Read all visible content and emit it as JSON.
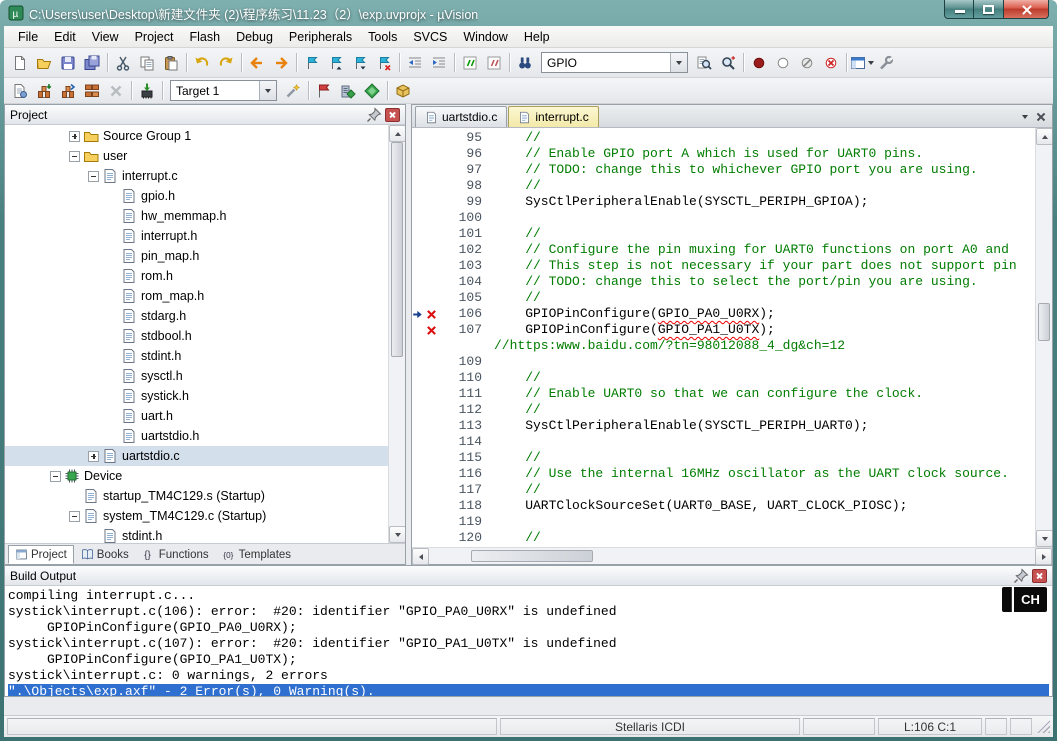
{
  "window": {
    "title": "C:\\Users\\user\\Desktop\\新建文件夹 (2)\\程序练习\\11.23（2）\\exp.uvprojx - µVision"
  },
  "menu": {
    "items": [
      "File",
      "Edit",
      "View",
      "Project",
      "Flash",
      "Debug",
      "Peripherals",
      "Tools",
      "SVCS",
      "Window",
      "Help"
    ]
  },
  "toolbar_file": {
    "items": [
      {
        "name": "new-file"
      },
      {
        "name": "open-file"
      },
      {
        "name": "save"
      },
      {
        "name": "save-all"
      },
      {
        "sep": true
      },
      {
        "name": "cut"
      },
      {
        "name": "copy"
      },
      {
        "name": "paste"
      },
      {
        "sep": true
      },
      {
        "name": "undo"
      },
      {
        "name": "redo"
      },
      {
        "sep": true
      },
      {
        "name": "navigate-back"
      },
      {
        "name": "navigate-forward"
      },
      {
        "sep": true
      },
      {
        "name": "bookmark-toggle"
      },
      {
        "name": "bookmark-prev"
      },
      {
        "name": "bookmark-next"
      },
      {
        "name": "bookmark-clear-all"
      },
      {
        "sep": true
      },
      {
        "name": "unindent"
      },
      {
        "name": "indent"
      },
      {
        "sep": true
      },
      {
        "name": "comment-selection"
      },
      {
        "name": "uncomment-selection"
      },
      {
        "sep": true
      },
      {
        "name": "find-in-files"
      },
      {
        "combo": "GPIO",
        "cname": "search"
      },
      {
        "name": "find"
      },
      {
        "name": "incremental-find"
      },
      {
        "sep": true
      },
      {
        "name": "breakpoint-toggle"
      },
      {
        "name": "breakpoint-enable-disable"
      },
      {
        "name": "breakpoint-disable-all"
      },
      {
        "name": "breakpoint-kill-all"
      },
      {
        "sep": true
      },
      {
        "name": "window-layout",
        "drop": true
      },
      {
        "name": "configure"
      }
    ]
  },
  "toolbar_build": {
    "items": [
      {
        "name": "translate"
      },
      {
        "name": "build"
      },
      {
        "name": "rebuild"
      },
      {
        "name": "batch-build"
      },
      {
        "name": "stop-build"
      },
      {
        "sep": true
      },
      {
        "name": "download"
      },
      {
        "sep": true
      },
      {
        "combo": "Target 1",
        "cname": "target-select"
      },
      {
        "name": "target-options"
      },
      {
        "sep": true
      },
      {
        "name": "file-extensions"
      },
      {
        "name": "manage-project-items"
      },
      {
        "name": "manage-rte"
      },
      {
        "sep": true
      },
      {
        "name": "pack-installer"
      }
    ]
  },
  "project_panel": {
    "title": "Project",
    "tree": [
      {
        "label": "Source Group 1",
        "depth": 2,
        "icon": "folder",
        "expander": "plus"
      },
      {
        "label": "user",
        "depth": 2,
        "icon": "folder",
        "expander": "minus"
      },
      {
        "label": "interrupt.c",
        "depth": 3,
        "icon": "file-c",
        "expander": "minus"
      },
      {
        "label": "gpio.h",
        "depth": 4,
        "icon": "file-h"
      },
      {
        "label": "hw_memmap.h",
        "depth": 4,
        "icon": "file-h"
      },
      {
        "label": "interrupt.h",
        "depth": 4,
        "icon": "file-h"
      },
      {
        "label": "pin_map.h",
        "depth": 4,
        "icon": "file-h"
      },
      {
        "label": "rom.h",
        "depth": 4,
        "icon": "file-h"
      },
      {
        "label": "rom_map.h",
        "depth": 4,
        "icon": "file-h"
      },
      {
        "label": "stdarg.h",
        "depth": 4,
        "icon": "file-h"
      },
      {
        "label": "stdbool.h",
        "depth": 4,
        "icon": "file-h"
      },
      {
        "label": "stdint.h",
        "depth": 4,
        "icon": "file-h"
      },
      {
        "label": "sysctl.h",
        "depth": 4,
        "icon": "file-h"
      },
      {
        "label": "systick.h",
        "depth": 4,
        "icon": "file-h"
      },
      {
        "label": "uart.h",
        "depth": 4,
        "icon": "file-h"
      },
      {
        "label": "uartstdio.h",
        "depth": 4,
        "icon": "file-h"
      },
      {
        "label": "uartstdio.c",
        "depth": 3,
        "icon": "file-c",
        "expander": "plus",
        "selected": true
      },
      {
        "label": "Device",
        "depth": 1,
        "icon": "device",
        "expander": "minus"
      },
      {
        "label": "startup_TM4C129.s (Startup)",
        "depth": 2,
        "icon": "file-s"
      },
      {
        "label": "system_TM4C129.c (Startup)",
        "depth": 2,
        "icon": "file-c",
        "expander": "minus"
      },
      {
        "label": "stdint.h",
        "depth": 3,
        "icon": "file-h"
      }
    ],
    "tabs": [
      {
        "label": "Project",
        "icon": "project-tab",
        "active": true
      },
      {
        "label": "Books",
        "icon": "books-tab"
      },
      {
        "label": "Functions",
        "icon": "functions-tab"
      },
      {
        "label": "Templates",
        "icon": "templates-tab"
      }
    ]
  },
  "editor": {
    "tabs": [
      {
        "label": "uartstdio.c",
        "active": false
      },
      {
        "label": "interrupt.c",
        "active": true
      }
    ],
    "lines": [
      {
        "num": "95",
        "parts": [
          {
            "t": "    //",
            "c": "com"
          }
        ]
      },
      {
        "num": "96",
        "parts": [
          {
            "t": "    // Enable GPIO port A which is used for UART0 pins.",
            "c": "com"
          }
        ]
      },
      {
        "num": "97",
        "parts": [
          {
            "t": "    // TODO: change this to whichever GPIO port you are using.",
            "c": "com"
          }
        ]
      },
      {
        "num": "98",
        "parts": [
          {
            "t": "    //",
            "c": "com"
          }
        ]
      },
      {
        "num": "99",
        "parts": [
          {
            "t": "    SysCtlPeripheralEnable(SYSCTL_PERIPH_GPIOA);",
            "c": "code"
          }
        ]
      },
      {
        "num": "100",
        "parts": []
      },
      {
        "num": "101",
        "parts": [
          {
            "t": "    //",
            "c": "com"
          }
        ]
      },
      {
        "num": "102",
        "parts": [
          {
            "t": "    // Configure the pin muxing for UART0 functions on port A0 and",
            "c": "com"
          }
        ]
      },
      {
        "num": "103",
        "parts": [
          {
            "t": "    // This step is not necessary if your part does not support pin",
            "c": "com"
          }
        ]
      },
      {
        "num": "104",
        "parts": [
          {
            "t": "    // TODO: change this to select the port/pin you are using.",
            "c": "com"
          }
        ]
      },
      {
        "num": "105",
        "parts": [
          {
            "t": "    //",
            "c": "com"
          }
        ]
      },
      {
        "num": "106",
        "marker": "error-current",
        "parts": [
          {
            "t": "    GPIOPinConfigure(",
            "c": "code"
          },
          {
            "t": "GPIO_PA0_U0RX",
            "c": "error"
          },
          {
            "t": ");",
            "c": "code"
          }
        ]
      },
      {
        "num": "107",
        "marker": "error",
        "parts": [
          {
            "t": "    GPIOPinConfigure(",
            "c": "code"
          },
          {
            "t": "GPIO_PA1_U0TX",
            "c": "error"
          },
          {
            "t": ");",
            "c": "code"
          }
        ]
      },
      {
        "num": "",
        "parts": [
          {
            "t": "//https:www.baidu.com/?tn=98012088_4_dg&ch=12",
            "c": "com"
          }
        ]
      },
      {
        "num": "109",
        "parts": []
      },
      {
        "num": "110",
        "parts": [
          {
            "t": "    //",
            "c": "com"
          }
        ]
      },
      {
        "num": "111",
        "parts": [
          {
            "t": "    // Enable UART0 so that we can configure the clock.",
            "c": "com"
          }
        ]
      },
      {
        "num": "112",
        "parts": [
          {
            "t": "    //",
            "c": "com"
          }
        ]
      },
      {
        "num": "113",
        "parts": [
          {
            "t": "    SysCtlPeripheralEnable(SYSCTL_PERIPH_UART0);",
            "c": "code"
          }
        ]
      },
      {
        "num": "114",
        "parts": []
      },
      {
        "num": "115",
        "parts": [
          {
            "t": "    //",
            "c": "com"
          }
        ]
      },
      {
        "num": "116",
        "parts": [
          {
            "t": "    // Use the internal 16MHz oscillator as the UART clock source.",
            "c": "com"
          }
        ]
      },
      {
        "num": "117",
        "parts": [
          {
            "t": "    //",
            "c": "com"
          }
        ]
      },
      {
        "num": "118",
        "parts": [
          {
            "t": "    UARTClockSourceSet(UART0_BASE, UART_CLOCK_PIOSC);",
            "c": "code"
          }
        ]
      },
      {
        "num": "119",
        "parts": []
      },
      {
        "num": "120",
        "parts": [
          {
            "t": "    //",
            "c": "com"
          }
        ]
      }
    ]
  },
  "build_output": {
    "title": "Build Output",
    "lines": [
      {
        "text": "compiling interrupt.c..."
      },
      {
        "text": "systick\\interrupt.c(106): error:  #20: identifier \"GPIO_PA0_U0RX\" is undefined"
      },
      {
        "text": "     GPIOPinConfigure(GPIO_PA0_U0RX);"
      },
      {
        "text": "systick\\interrupt.c(107): error:  #20: identifier \"GPIO_PA1_U0TX\" is undefined"
      },
      {
        "text": "     GPIOPinConfigure(GPIO_PA1_U0TX);"
      },
      {
        "text": "systick\\interrupt.c: 0 warnings, 2 errors"
      },
      {
        "text": "\".\\Objects\\exp.axf\" - 2 Error(s), 0 Warning(s).",
        "selected": true
      }
    ]
  },
  "ime": {
    "label": "CH"
  },
  "status_bar": {
    "debugger": "Stellaris ICDI",
    "cursor": "L:106 C:1"
  },
  "colors": {
    "titlebar_teal": "#3f7f7f",
    "comment_green": "#007d00",
    "error_red": "#dd1111",
    "selection_blue": "#2f6fd0",
    "active_tab_yellow": "#f3e9a9"
  }
}
